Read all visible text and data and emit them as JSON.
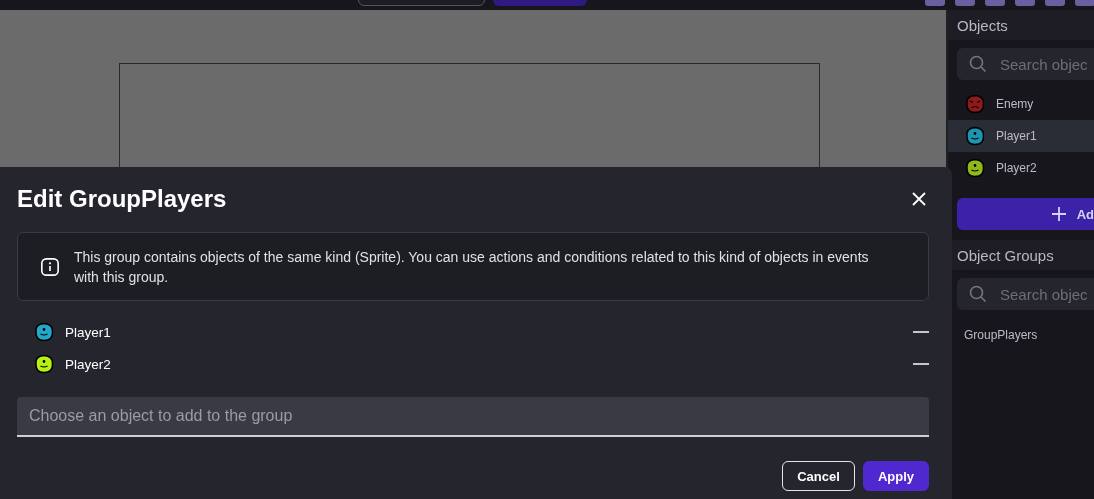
{
  "objects_panel": {
    "title": "Objects",
    "search": {
      "placeholder": "Search objec"
    },
    "items": [
      {
        "name": "Enemy",
        "color": "#8e1b1b",
        "kind": "angry",
        "selected": false
      },
      {
        "name": "Player1",
        "color": "#1b95b0",
        "kind": "happy",
        "selected": true
      },
      {
        "name": "Player2",
        "color": "#8fb81a",
        "kind": "happy",
        "selected": false
      }
    ],
    "add_button": "Ad"
  },
  "groups_panel": {
    "title": "Object Groups",
    "search": {
      "placeholder": "Search objec"
    },
    "items": [
      {
        "name": "GroupPlayers",
        "selected": false
      }
    ]
  },
  "dialog": {
    "title": "Edit GroupPlayers",
    "info": "This group contains objects of the same kind (Sprite). You can use actions and conditions related to this kind of objects in events with this group.",
    "members": [
      {
        "name": "Player1",
        "color": "#22a9c9",
        "kind": "happy"
      },
      {
        "name": "Player2",
        "color": "#b8f014",
        "kind": "happy"
      }
    ],
    "add_field": {
      "placeholder": "Choose an object to add to the group"
    },
    "buttons": [
      {
        "label": "Cancel",
        "kind": "secondary"
      },
      {
        "label": "Apply",
        "kind": "primary"
      }
    ]
  }
}
